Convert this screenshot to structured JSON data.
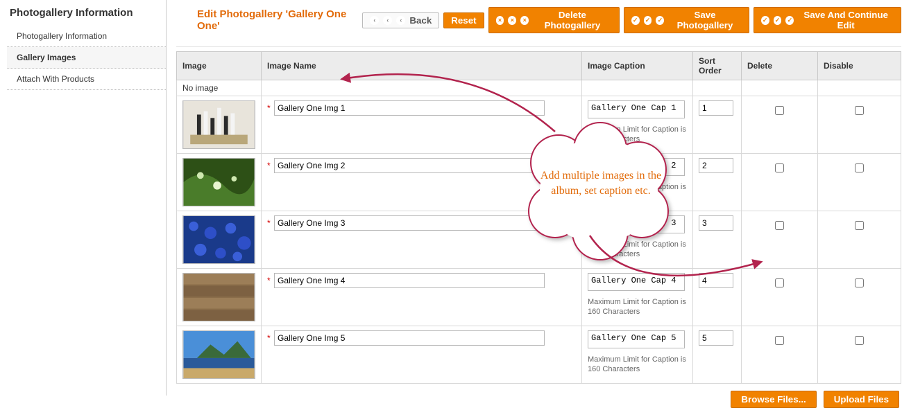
{
  "sidebar": {
    "title": "Photogallery Information",
    "items": [
      {
        "label": "Photogallery Information"
      },
      {
        "label": "Gallery Images"
      },
      {
        "label": "Attach With Products"
      }
    ]
  },
  "header": {
    "title": "Edit Photogallery 'Gallery One One'",
    "back_label": "Back",
    "reset_label": "Reset",
    "delete_label": "Delete Photogallery",
    "save_label": "Save Photogallery",
    "save_continue_label": "Save And Continue Edit"
  },
  "table": {
    "headers": {
      "image": "Image",
      "name": "Image Name",
      "caption": "Image Caption",
      "sort": "Sort Order",
      "delete": "Delete",
      "disable": "Disable"
    },
    "no_image": "No image",
    "caption_hint": "Maximum Limit for Caption is 160 Characters",
    "rows": [
      {
        "name": "Gallery One Img 1",
        "caption": "Gallery One Cap 1",
        "sort": "1"
      },
      {
        "name": "Gallery One Img 2",
        "caption": "Gallery One Cap 2",
        "sort": "2"
      },
      {
        "name": "Gallery One Img 3",
        "caption": "Gallery One Cap 3",
        "sort": "3"
      },
      {
        "name": "Gallery One Img 4",
        "caption": "Gallery One Cap 4",
        "sort": "4"
      },
      {
        "name": "Gallery One Img 5",
        "caption": "Gallery One Cap 5",
        "sort": "5"
      }
    ]
  },
  "footer": {
    "browse_label": "Browse Files...",
    "upload_label": "Upload Files"
  },
  "callout": {
    "text": "Add multiple images in the album, set caption etc."
  }
}
